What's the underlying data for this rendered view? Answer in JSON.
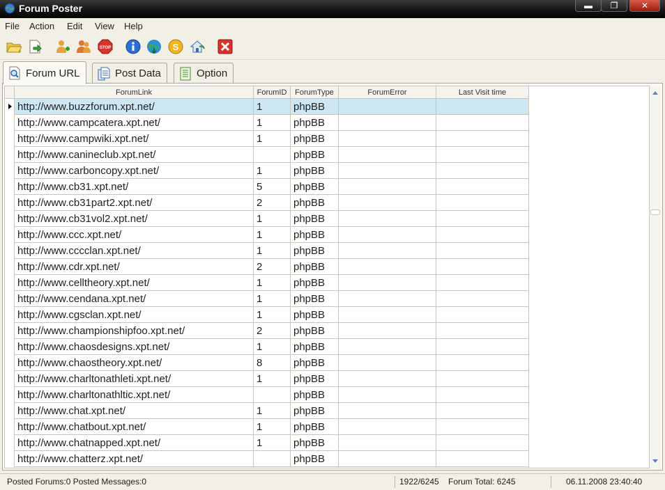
{
  "window": {
    "title": "Forum Poster",
    "minimize": "▬",
    "maximize": "❐",
    "close": "✕"
  },
  "menu": [
    "File",
    "Action",
    "Edit",
    "View",
    "Help"
  ],
  "toolbar": [
    "open-folder-icon",
    "export-icon",
    "add-user-icon",
    "users-icon",
    "stop-icon",
    "info-icon",
    "globe-icon",
    "dollar-icon",
    "home-icon",
    "close-red-icon"
  ],
  "tabs": [
    {
      "label": "Forum URL",
      "icon": "magnifier-page-icon"
    },
    {
      "label": "Post Data",
      "icon": "documents-icon"
    },
    {
      "label": "Option",
      "icon": "list-icon"
    }
  ],
  "table": {
    "columns": [
      "ForumLink",
      "ForumID",
      "ForumType",
      "ForumError",
      "Last Visit time"
    ],
    "rows": [
      [
        "http://www.buzzforum.xpt.net/",
        "1",
        "phpBB",
        "",
        ""
      ],
      [
        "http://www.campcatera.xpt.net/",
        "1",
        "phpBB",
        "",
        ""
      ],
      [
        "http://www.campwiki.xpt.net/",
        "1",
        "phpBB",
        "",
        ""
      ],
      [
        "http://www.canineclub.xpt.net/",
        "",
        "phpBB",
        "",
        ""
      ],
      [
        "http://www.carboncopy.xpt.net/",
        "1",
        "phpBB",
        "",
        ""
      ],
      [
        "http://www.cb31.xpt.net/",
        "5",
        "phpBB",
        "",
        ""
      ],
      [
        "http://www.cb31part2.xpt.net/",
        "2",
        "phpBB",
        "",
        ""
      ],
      [
        "http://www.cb31vol2.xpt.net/",
        "1",
        "phpBB",
        "",
        ""
      ],
      [
        "http://www.ccc.xpt.net/",
        "1",
        "phpBB",
        "",
        ""
      ],
      [
        "http://www.cccclan.xpt.net/",
        "1",
        "phpBB",
        "",
        ""
      ],
      [
        "http://www.cdr.xpt.net/",
        "2",
        "phpBB",
        "",
        ""
      ],
      [
        "http://www.celltheory.xpt.net/",
        "1",
        "phpBB",
        "",
        ""
      ],
      [
        "http://www.cendana.xpt.net/",
        "1",
        "phpBB",
        "",
        ""
      ],
      [
        "http://www.cgsclan.xpt.net/",
        "1",
        "phpBB",
        "",
        ""
      ],
      [
        "http://www.championshipfoo.xpt.net/",
        "2",
        "phpBB",
        "",
        ""
      ],
      [
        "http://www.chaosdesigns.xpt.net/",
        "1",
        "phpBB",
        "",
        ""
      ],
      [
        "http://www.chaostheory.xpt.net/",
        "8",
        "phpBB",
        "",
        ""
      ],
      [
        "http://www.charltonathleti.xpt.net/",
        "1",
        "phpBB",
        "",
        ""
      ],
      [
        "http://www.charltonathltic.xpt.net/",
        "",
        "phpBB",
        "",
        ""
      ],
      [
        "http://www.chat.xpt.net/",
        "1",
        "phpBB",
        "",
        ""
      ],
      [
        "http://www.chatbout.xpt.net/",
        "1",
        "phpBB",
        "",
        ""
      ],
      [
        "http://www.chatnapped.xpt.net/",
        "1",
        "phpBB",
        "",
        ""
      ],
      [
        "http://www.chatterz.xpt.net/",
        "",
        "phpBB",
        "",
        ""
      ]
    ],
    "selected_row": 0
  },
  "status": {
    "posted": "Posted Forums:0 Posted Messages:0",
    "progress": "1922/6245",
    "total": "Forum Total: 6245",
    "datetime": "06.11.2008 23:40:40"
  }
}
